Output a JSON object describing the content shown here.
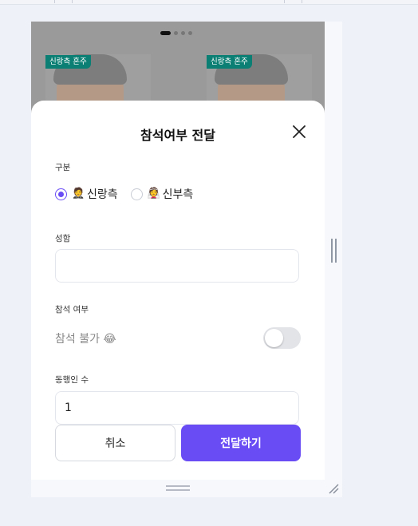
{
  "carousel": {
    "tag_left": "신랑측 혼주",
    "tag_right": "신랑측 혼주"
  },
  "modal": {
    "title": "참석여부 전달",
    "side_label": "구분",
    "side_options": [
      {
        "label": "신랑측",
        "selected": true
      },
      {
        "label": "신부측",
        "selected": false
      }
    ],
    "name_label": "성함",
    "name_value": "",
    "attendance_label": "참석 여부",
    "attendance_status": "참석 불가 😂",
    "attendance_on": false,
    "companions_label": "동행인 수",
    "companions_value": "1",
    "cancel_label": "취소",
    "submit_label": "전달하기"
  },
  "colors": {
    "accent": "#6a4cf5",
    "tag": "#0b7f73"
  }
}
